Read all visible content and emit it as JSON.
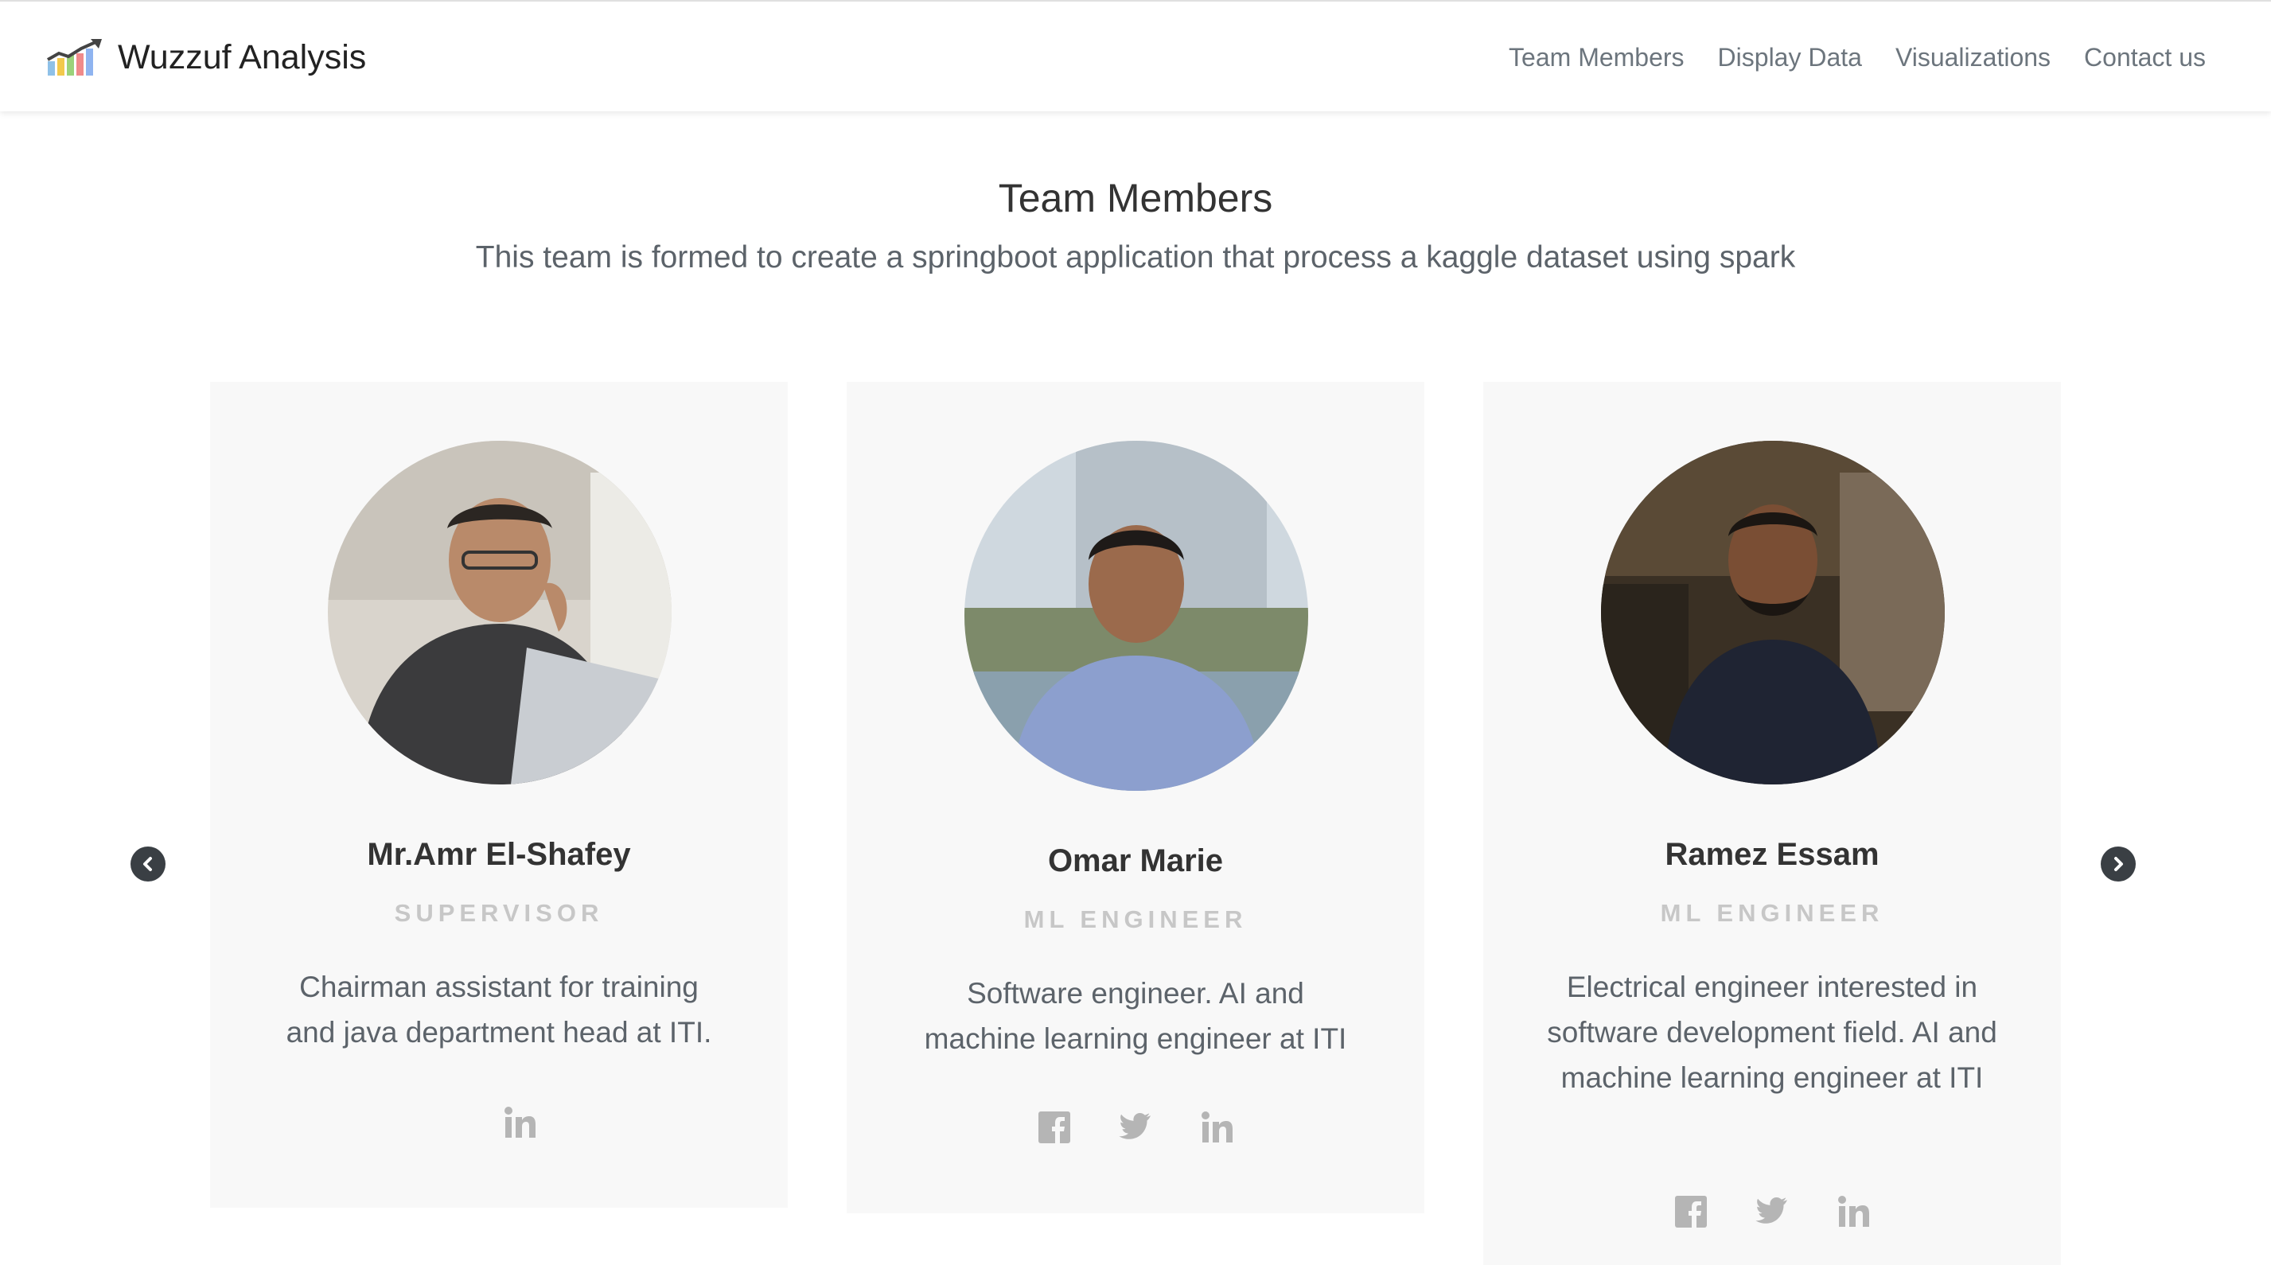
{
  "brand": {
    "title": "Wuzzuf Analysis"
  },
  "nav": {
    "items": [
      "Team Members",
      "Display Data",
      "Visualizations",
      "Contact us"
    ]
  },
  "section": {
    "title": "Team Members",
    "subtitle": "This team is formed to create a springboot application that process a kaggle dataset using spark"
  },
  "members": [
    {
      "name": "Mr.Amr El-Shafey",
      "role": "SUPERVISOR",
      "bio": "Chairman assistant for training and java department head at ITI.",
      "socials": [
        "linkedin-icon"
      ]
    },
    {
      "name": "Omar Marie",
      "role": "ML ENGINEER",
      "bio": "Software engineer. AI and machine learning engineer at ITI",
      "socials": [
        "facebook-icon",
        "twitter-icon",
        "linkedin-icon"
      ]
    },
    {
      "name": "Ramez Essam",
      "role": "ML ENGINEER",
      "bio": "Electrical engineer interested in software development field. AI and machine learning engineer at ITI",
      "socials": [
        "facebook-icon",
        "twitter-icon",
        "linkedin-icon"
      ]
    }
  ],
  "colors": {
    "nav_text": "#6c757d",
    "card_bg": "#f8f8f8",
    "role_text": "#c7c7c7",
    "icon": "#b5b5b5",
    "arrow_bg": "#3a3f44"
  }
}
